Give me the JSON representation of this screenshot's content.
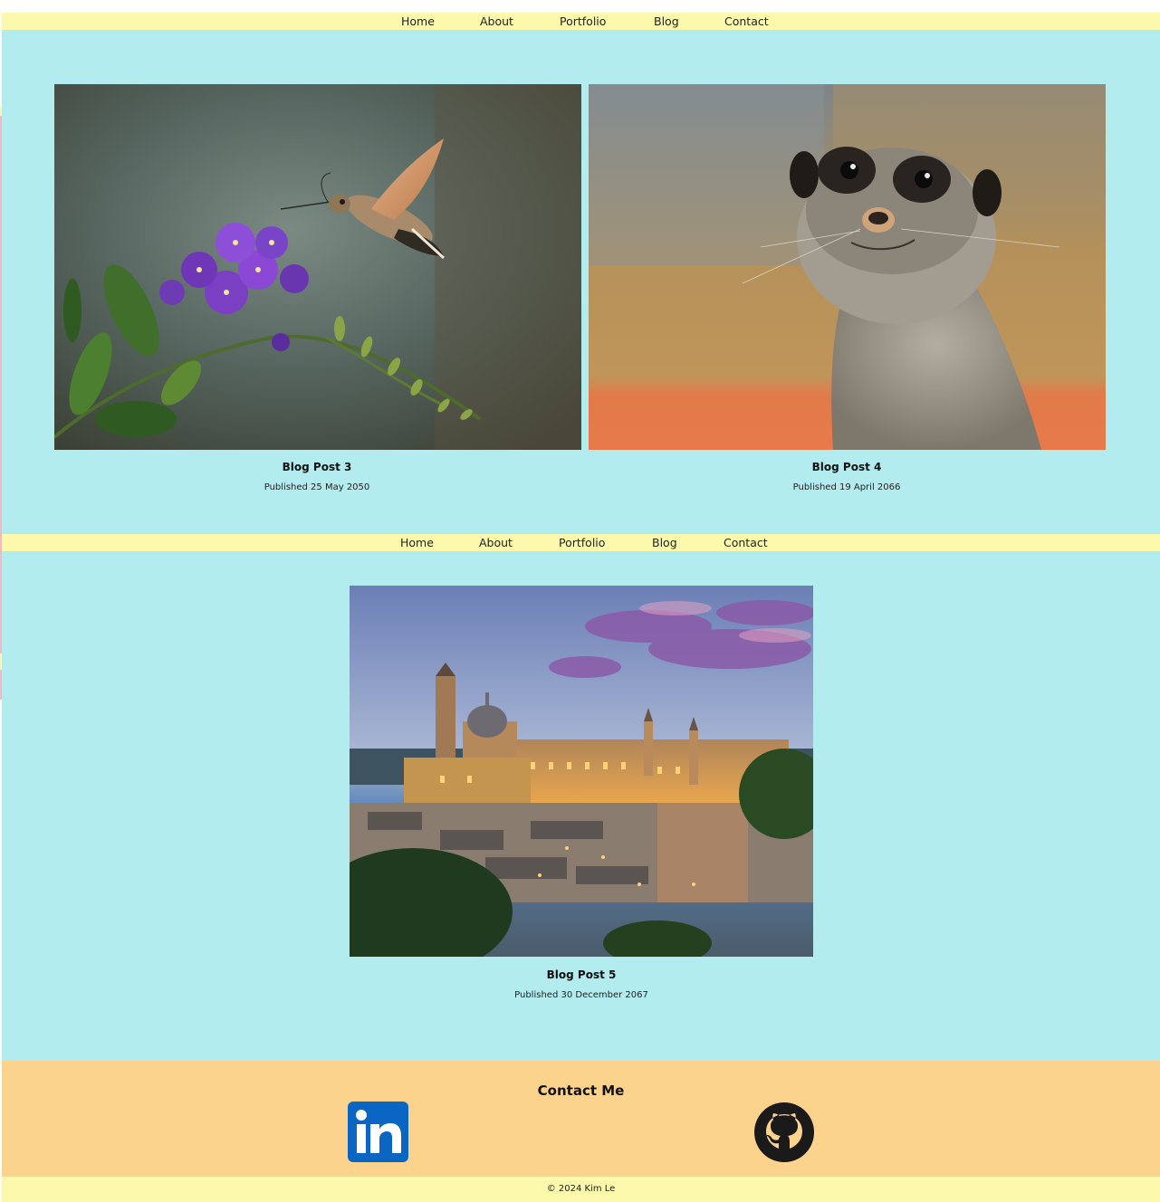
{
  "nav": {
    "items": [
      {
        "label": "Home"
      },
      {
        "label": "About"
      },
      {
        "label": "Portfolio"
      },
      {
        "label": "Blog"
      },
      {
        "label": "Contact"
      }
    ]
  },
  "posts": [
    {
      "title": "Blog Post 3",
      "date": "Published 25 May 2050",
      "image": "hummingbird-moth-flower"
    },
    {
      "title": "Blog Post 4",
      "date": "Published 19 April 2066",
      "image": "meerkat"
    },
    {
      "title": "Blog Post 5",
      "date": "Published 30 December 2067",
      "image": "hilltop-town-at-dusk"
    }
  ],
  "footer": {
    "heading": "Contact Me",
    "linkedin_icon": "linkedin-icon",
    "github_icon": "github-icon",
    "copyright": "© 2024 Kim Le"
  },
  "colors": {
    "nav_bg": "#fcf9ad",
    "page_bg": "#b2ecef",
    "footer_bg": "#fcd38c",
    "linkedin_blue": "#0a66c2"
  }
}
